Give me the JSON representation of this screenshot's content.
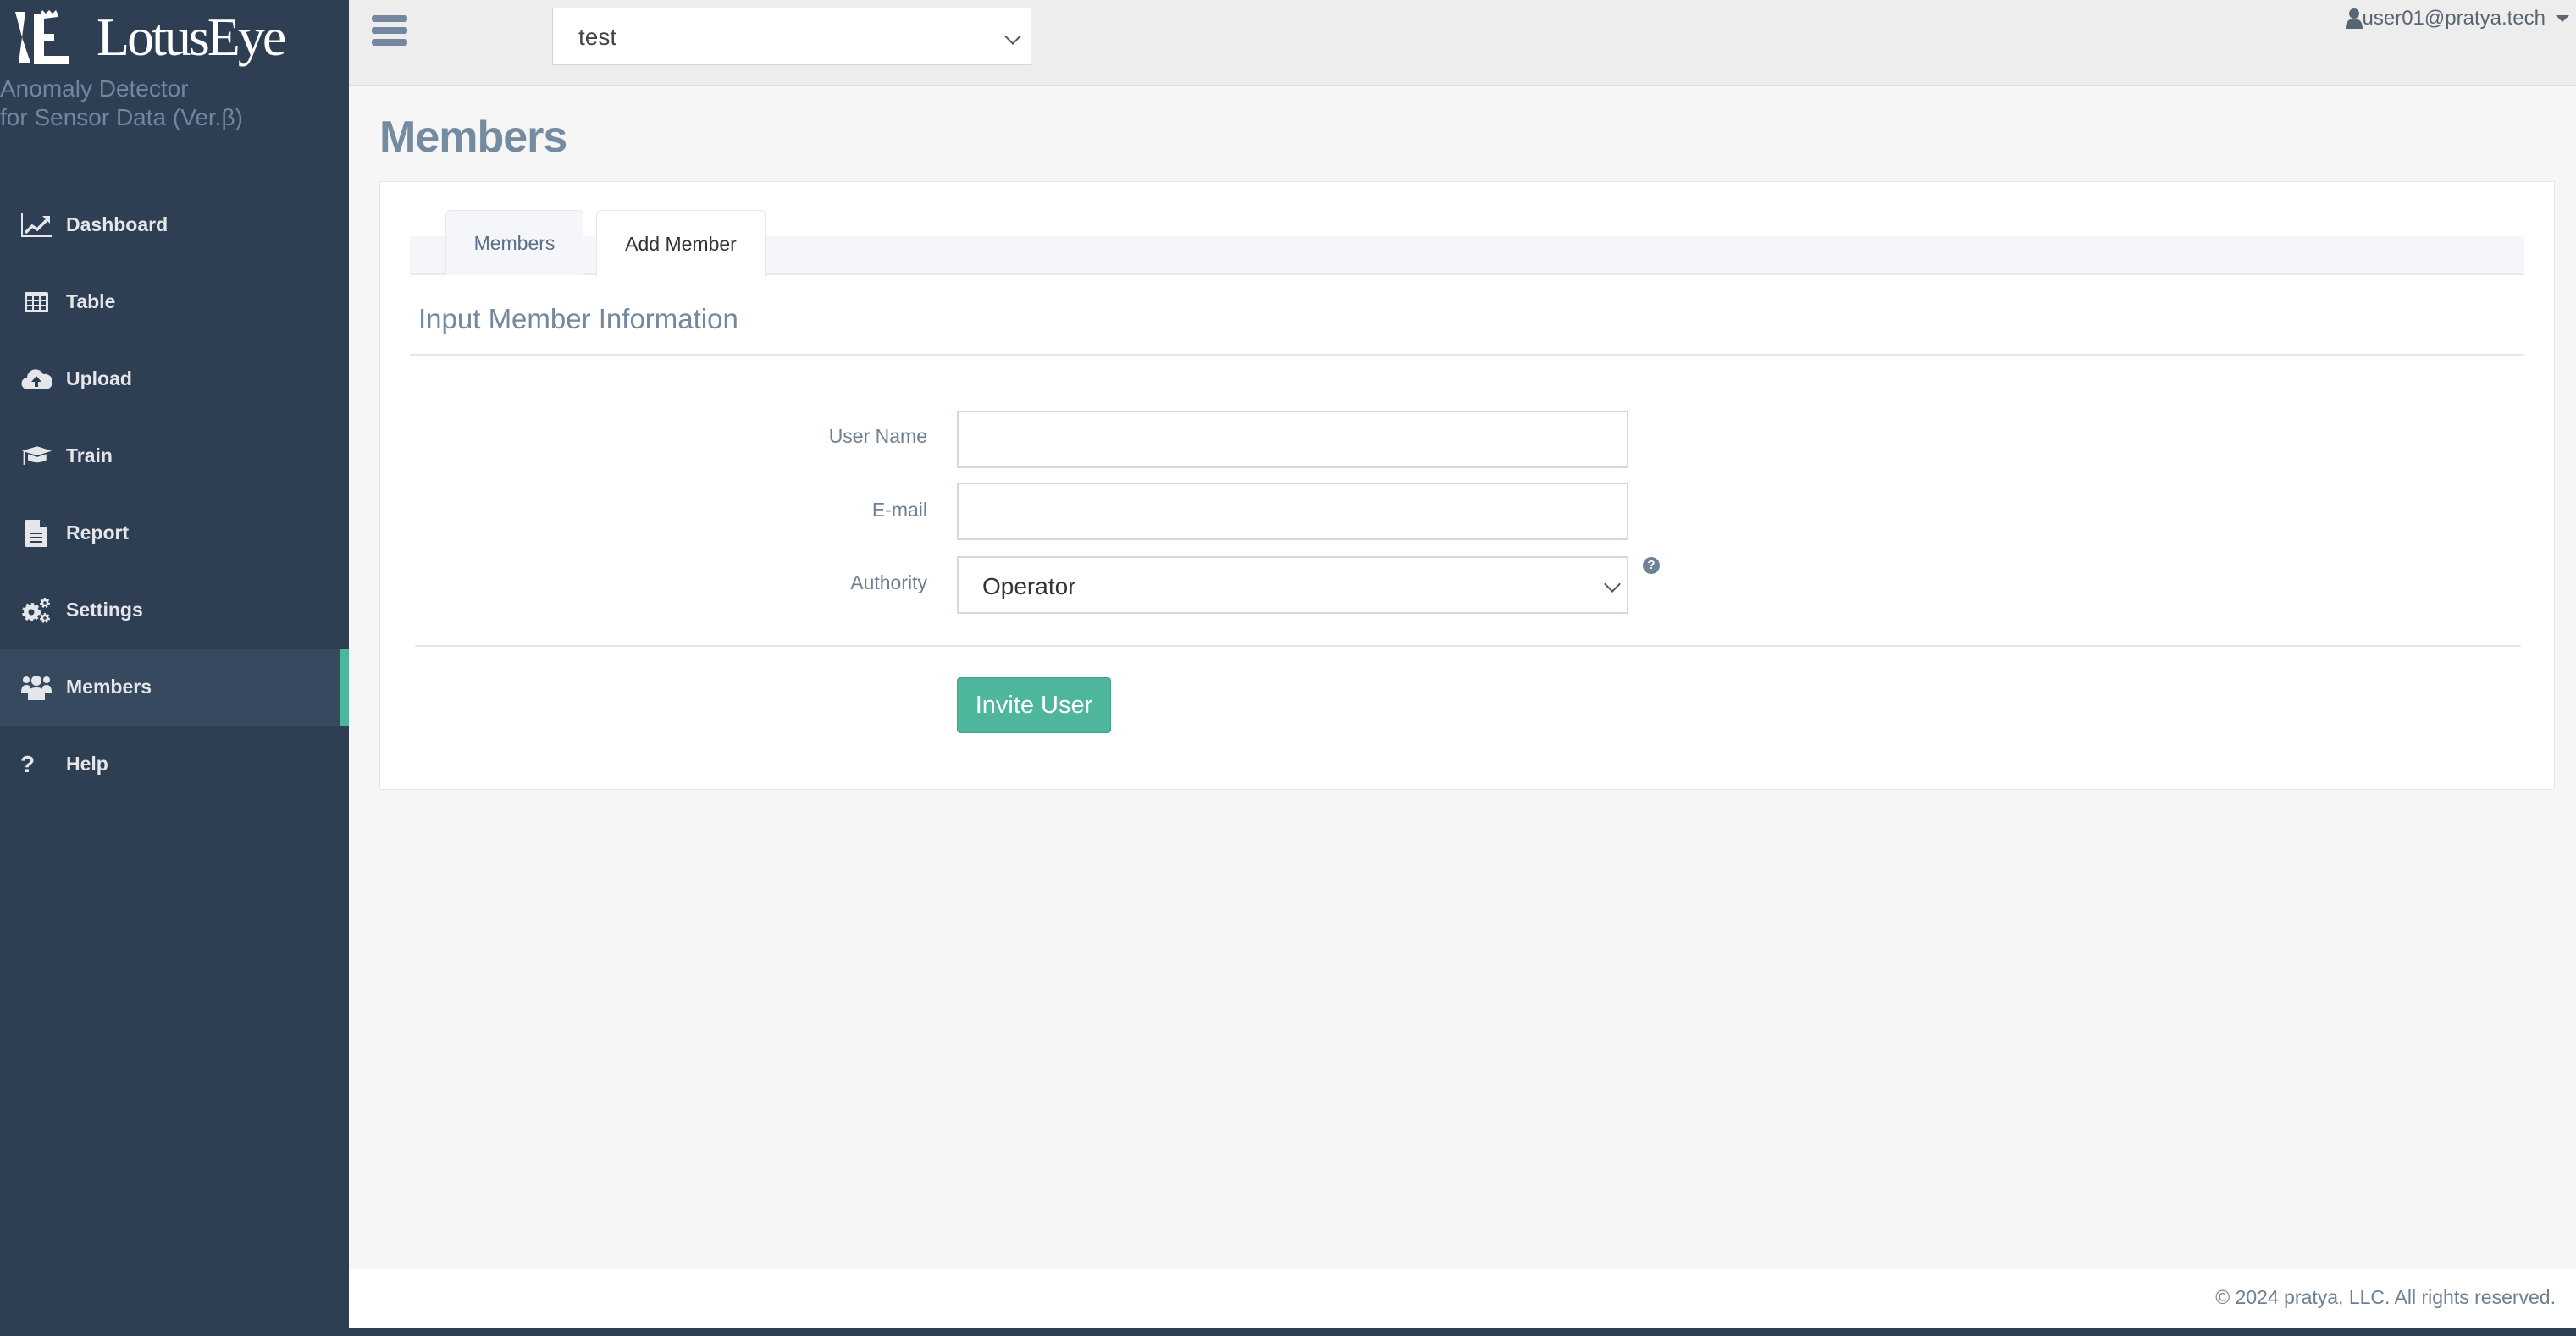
{
  "brand": {
    "name": "LotusEye",
    "tagline_line1": "Anomaly Detector",
    "tagline_line2": "for Sensor Data (Ver.β)"
  },
  "sidebar": {
    "items": [
      {
        "label": "Dashboard",
        "icon": "line-chart-icon",
        "active": false
      },
      {
        "label": "Table",
        "icon": "table-icon",
        "active": false
      },
      {
        "label": "Upload",
        "icon": "cloud-upload-icon",
        "active": false
      },
      {
        "label": "Train",
        "icon": "graduation-cap-icon",
        "active": false
      },
      {
        "label": "Report",
        "icon": "file-text-icon",
        "active": false
      },
      {
        "label": "Settings",
        "icon": "gears-icon",
        "active": false
      },
      {
        "label": "Members",
        "icon": "users-icon",
        "active": true
      },
      {
        "label": "Help",
        "icon": "question-icon",
        "active": false
      }
    ],
    "accent_color": "#4db69c"
  },
  "topbar": {
    "project_select_value": "test",
    "user_email": "user01@pratya.tech"
  },
  "page": {
    "title": "Members",
    "tabs": [
      {
        "label": "Members",
        "active": false
      },
      {
        "label": "Add Member",
        "active": true
      }
    ],
    "section_title": "Input Member Information",
    "form": {
      "user_name_label": "User Name",
      "user_name_value": "",
      "email_label": "E-mail",
      "email_value": "",
      "authority_label": "Authority",
      "authority_value": "Operator",
      "help_glyph": "?",
      "submit_label": "Invite User"
    }
  },
  "footer": {
    "copyright": "© 2024 pratya, LLC. All rights reserved."
  }
}
